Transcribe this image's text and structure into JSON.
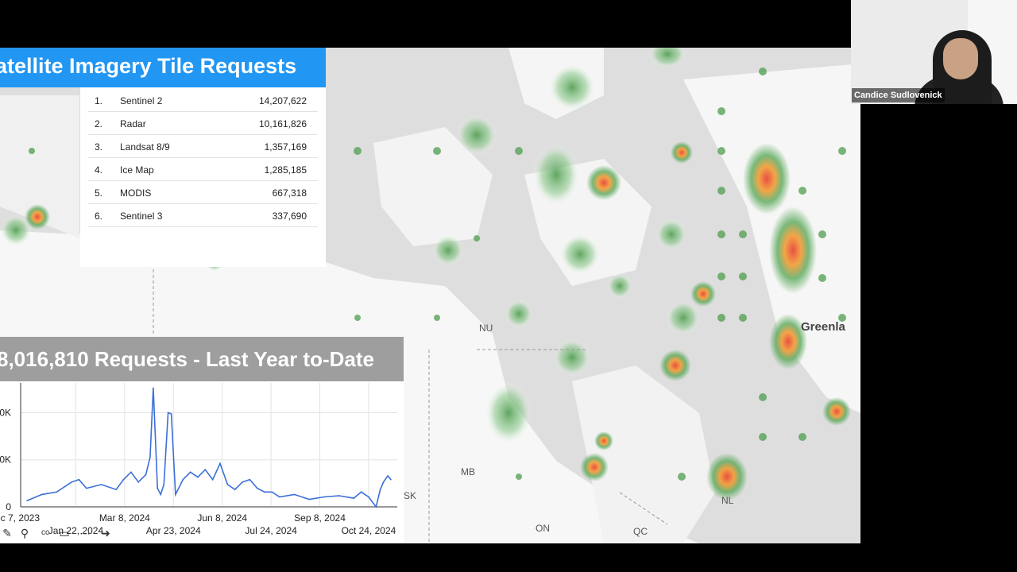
{
  "slide": {
    "title": "atellite Imagery Tile Requests",
    "ranking": [
      {
        "rank": "1.",
        "name": "Sentinel 2",
        "value": "14,207,622"
      },
      {
        "rank": "2.",
        "name": "Radar",
        "value": "10,161,826"
      },
      {
        "rank": "3.",
        "name": "Landsat 8/9",
        "value": "1,357,169"
      },
      {
        "rank": "4.",
        "name": "Ice Map",
        "value": "1,285,185"
      },
      {
        "rank": "5.",
        "name": "MODIS",
        "value": "667,318"
      },
      {
        "rank": "6.",
        "name": "Sentinel 3",
        "value": "337,690"
      }
    ],
    "requests_title": "8,016,810 Requests - Last Year to-Date",
    "map_labels": {
      "nu": "NU",
      "greenland": "Greenla",
      "mb": "MB",
      "sk": "SK",
      "nl": "NL",
      "on": "ON",
      "qc": "QC"
    }
  },
  "chart_data": {
    "type": "line",
    "title": "8,016,810 Requests - Last Year to-Date",
    "y_tick_labels": [
      "0",
      "0K",
      "0K"
    ],
    "x_tick_labels_row1": [
      "ec 7, 2023",
      "Mar 8, 2024",
      "Jun 8, 2024",
      "Sep 8, 2024"
    ],
    "x_tick_labels_row2": [
      "Jan 22, 2024",
      "Apr 23, 2024",
      "Jul 24, 2024",
      "Oct 24, 2024"
    ],
    "ylim": [
      0,
      100
    ],
    "series_color": "#3b6fd8",
    "series": [
      {
        "x": [
          "2023-12-07",
          "2023-12-21",
          "2024-01-04",
          "2024-01-18",
          "2024-01-25",
          "2024-02-01",
          "2024-02-15",
          "2024-02-29",
          "2024-03-07",
          "2024-03-14",
          "2024-03-21",
          "2024-03-28",
          "2024-04-01",
          "2024-04-04",
          "2024-04-08",
          "2024-04-11",
          "2024-04-14",
          "2024-04-18",
          "2024-04-21",
          "2024-04-25",
          "2024-05-02",
          "2024-05-09",
          "2024-05-16",
          "2024-05-23",
          "2024-05-30",
          "2024-06-06",
          "2024-06-13",
          "2024-06-20",
          "2024-06-27",
          "2024-07-04",
          "2024-07-11",
          "2024-07-18",
          "2024-07-25",
          "2024-08-01",
          "2024-08-15",
          "2024-08-29",
          "2024-09-12",
          "2024-09-26",
          "2024-10-10",
          "2024-10-17",
          "2024-10-24",
          "2024-10-31",
          "2024-11-04",
          "2024-11-07",
          "2024-11-11",
          "2024-11-14"
        ],
        "y": [
          5,
          10,
          12,
          20,
          22,
          15,
          18,
          14,
          22,
          28,
          20,
          26,
          40,
          96,
          15,
          10,
          18,
          76,
          75,
          10,
          22,
          28,
          24,
          30,
          22,
          35,
          18,
          14,
          20,
          22,
          15,
          12,
          12,
          8,
          10,
          6,
          8,
          9,
          7,
          12,
          8,
          0,
          14,
          20,
          25,
          22
        ]
      }
    ]
  },
  "webcam": {
    "name": "Candice Sudlovenick"
  },
  "colors": {
    "title_banner": "#2196f3",
    "requests_banner": "#9e9e9e"
  },
  "toolbar": {
    "icons": [
      "pencil-icon",
      "search-icon",
      "cc-icon",
      "toolbar-icon",
      "more-icon",
      "next-icon"
    ]
  }
}
